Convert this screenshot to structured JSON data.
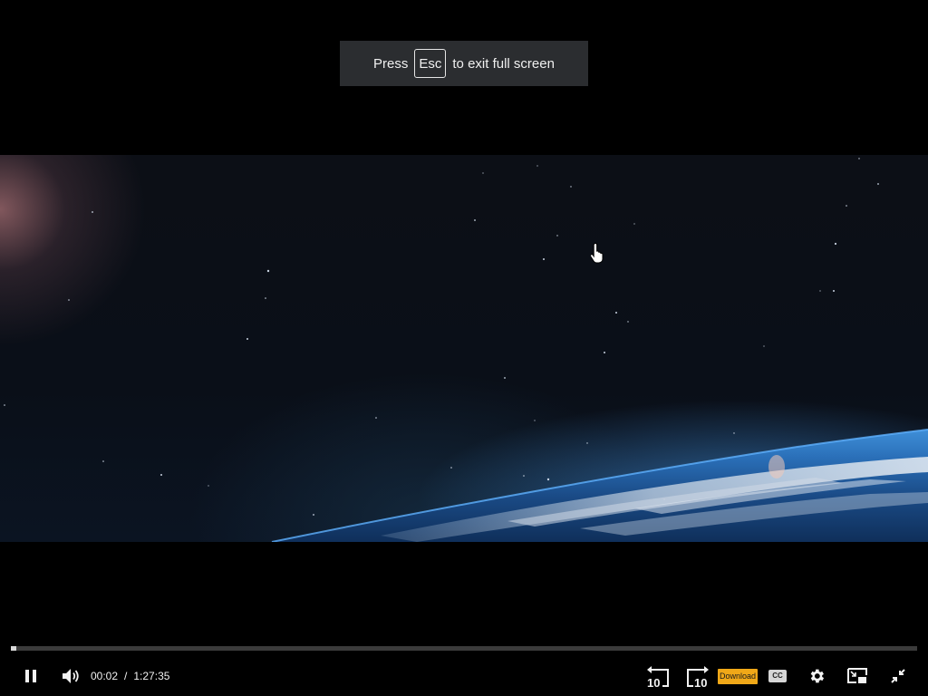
{
  "fullscreen_notice": {
    "prefix": "Press",
    "key": "Esc",
    "suffix": "to exit full screen"
  },
  "player": {
    "current_time": "00:02",
    "separator": "/",
    "duration": "1:27:35",
    "progress_fraction": 0.006,
    "rewind_label": "10",
    "forward_label": "10",
    "download_label": "Download",
    "cc_label": "CC",
    "icons": {
      "pause": "pause-icon",
      "volume": "volume-icon",
      "rewind": "rewind-10-icon",
      "forward": "forward-10-icon",
      "settings": "gear-icon",
      "pip": "picture-in-picture-icon",
      "exit_fullscreen": "exit-fullscreen-icon"
    },
    "colors": {
      "download_bg": "#f0a818",
      "progress_played": "#d8d8d8",
      "progress_track": "#3b3b3b"
    }
  }
}
